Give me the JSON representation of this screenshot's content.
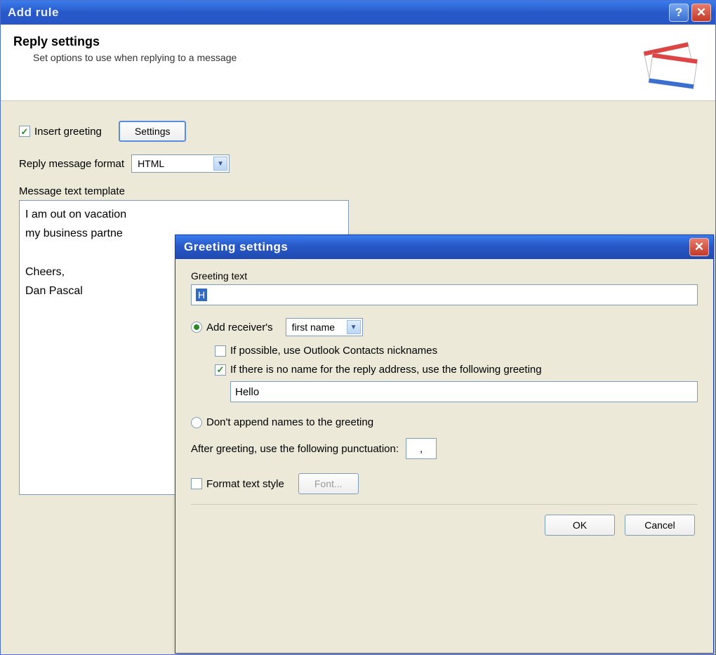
{
  "outer": {
    "title": "Add rule",
    "header_title": "Reply settings",
    "header_sub": "Set options to use when replying to a message"
  },
  "form": {
    "insert_greeting_label": "Insert greeting",
    "settings_button": "Settings",
    "reply_format_label": "Reply message format",
    "reply_format_value": "HTML",
    "template_label": "Message text template",
    "template_text": "I am out on vacation\nmy business partne\n\nCheers,\nDan Pascal"
  },
  "greeting": {
    "title": "Greeting settings",
    "greeting_text_label": "Greeting text",
    "greeting_text_value": "H",
    "radio_add_receivers": "Add receiver's",
    "name_part_value": "first name",
    "cb_nicknames": "If possible, use Outlook Contacts nicknames",
    "cb_noname": "If there is no name for the reply address, use the following greeting",
    "noname_value": "Hello",
    "radio_noappend": "Don't append names to the greeting",
    "punct_label": "After greeting, use the following punctuation:",
    "punct_value": ",",
    "cb_format_style": "Format text style",
    "font_button": "Font...",
    "ok_button": "OK",
    "cancel_button": "Cancel"
  }
}
